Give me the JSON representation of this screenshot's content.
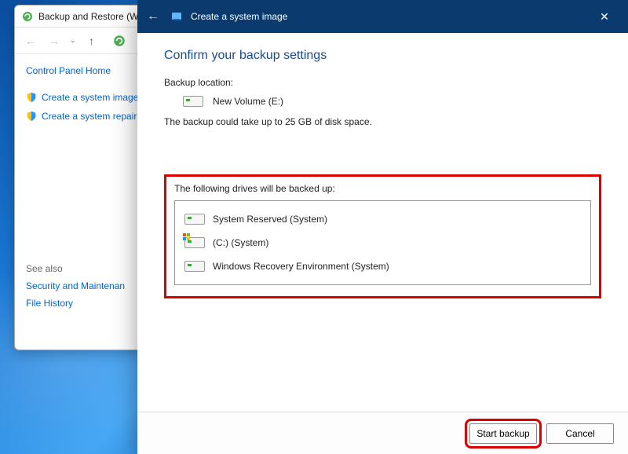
{
  "parent": {
    "title": "Backup and Restore (Wi",
    "cp_home": "Control Panel Home",
    "tasks": [
      "Create a system image",
      "Create a system repair d"
    ],
    "see_also_label": "See also",
    "see_also": [
      "Security and Maintenan",
      "File History"
    ]
  },
  "wizard": {
    "title": "Create a system image",
    "heading": "Confirm your backup settings",
    "backup_location_label": "Backup location:",
    "backup_location_value": "New Volume (E:)",
    "size_warning": "The backup could take up to 25 GB of disk space.",
    "drives_label": "The following drives will be backed up:",
    "drives": [
      "System Reserved (System)",
      "(C:) (System)",
      "Windows Recovery Environment (System)"
    ],
    "buttons": {
      "start": "Start backup",
      "cancel": "Cancel"
    }
  }
}
